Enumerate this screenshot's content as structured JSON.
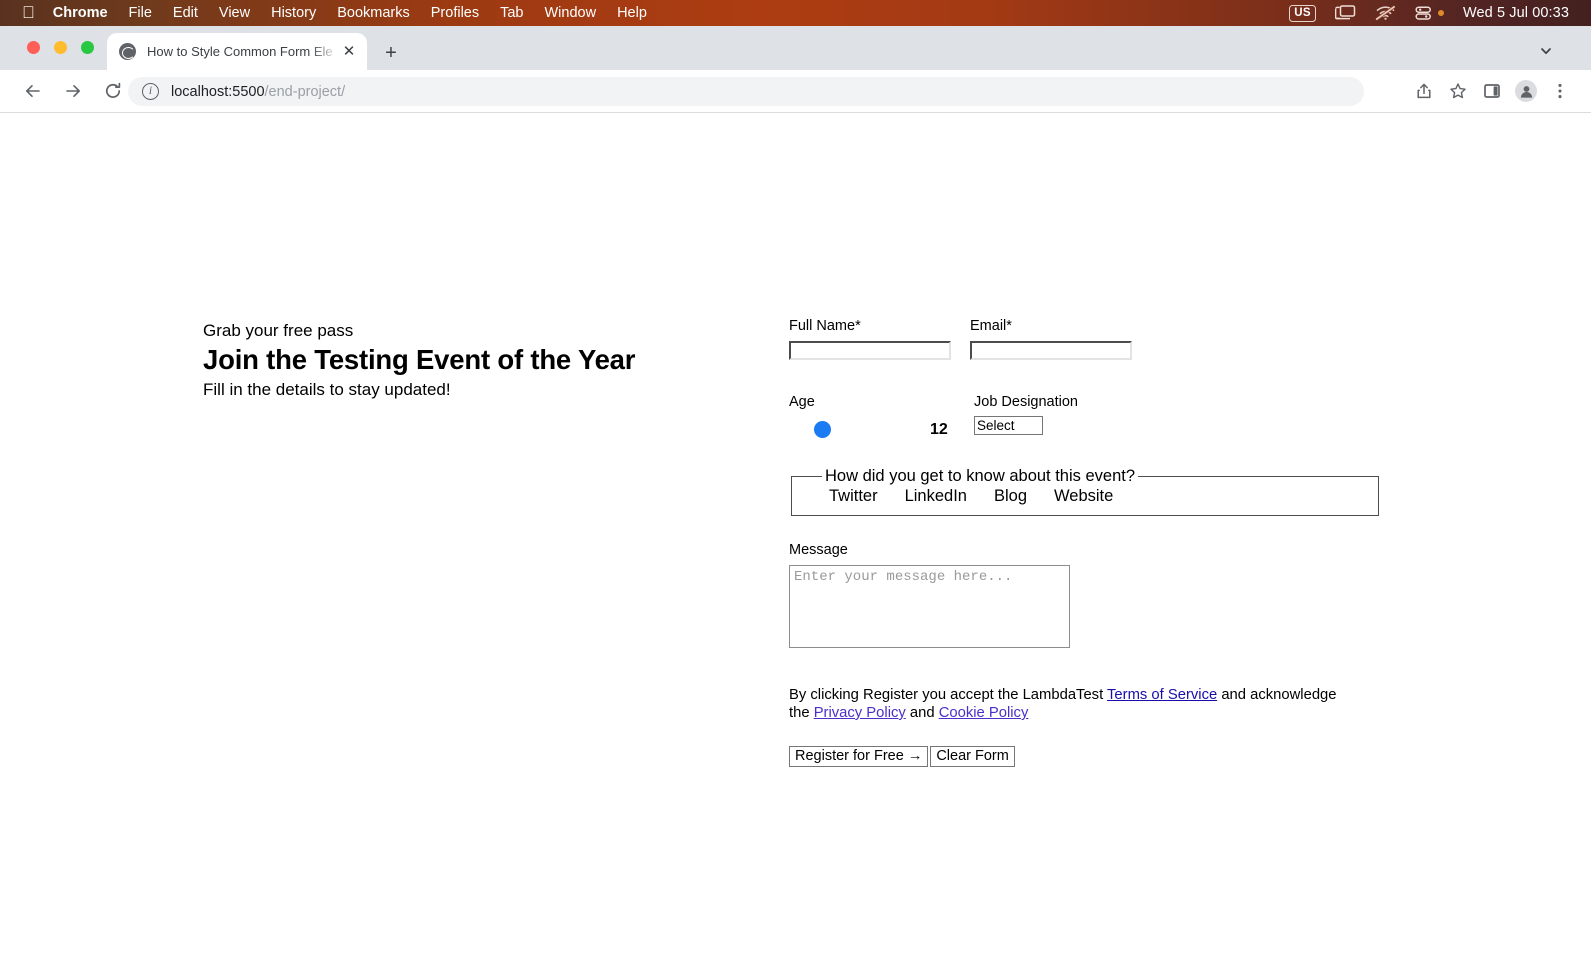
{
  "menubar": {
    "apple_icon": "apple-logo-icon",
    "items": [
      {
        "label": "Chrome",
        "bold": true
      },
      {
        "label": "File",
        "bold": false
      },
      {
        "label": "Edit",
        "bold": false
      },
      {
        "label": "View",
        "bold": false
      },
      {
        "label": "History",
        "bold": false
      },
      {
        "label": "Bookmarks",
        "bold": false
      },
      {
        "label": "Profiles",
        "bold": false
      },
      {
        "label": "Tab",
        "bold": false
      },
      {
        "label": "Window",
        "bold": false
      },
      {
        "label": "Help",
        "bold": false
      }
    ],
    "status": {
      "input_source": "US",
      "screen_mirroring_icon": "screen-mirroring-icon",
      "wifi_icon": "wifi-off-icon",
      "control_center_icon": "control-center-icon",
      "clock": "Wed 5 Jul  00:33"
    }
  },
  "browser": {
    "tab": {
      "title": "How to Style Common Form Ele",
      "favicon": "globe-icon",
      "close_label": "✕"
    },
    "new_tab_label": "+",
    "tab_list_chevron": "chevron-down-icon",
    "nav": {
      "back": "←",
      "forward": "→",
      "reload": "⟳"
    },
    "omnibox": {
      "site_info_icon": "info-circle-icon",
      "url_host": "localhost:5500",
      "url_path": "/end-project/"
    },
    "actions": {
      "share": "share-icon",
      "bookmark": "star-icon",
      "side_panel": "side-panel-icon",
      "profile": "profile-avatar-icon",
      "menu": "three-dot-menu-icon"
    }
  },
  "page": {
    "hero": {
      "eyebrow": "Grab your free pass",
      "heading": "Join the Testing Event of the Year",
      "subheading": "Fill in the details to stay updated!"
    },
    "form": {
      "full_name": {
        "label": "Full Name*",
        "value": "",
        "placeholder": ""
      },
      "email": {
        "label": "Email*",
        "value": "",
        "placeholder": ""
      },
      "age": {
        "label": "Age",
        "value": "12",
        "min": "1",
        "max": "100"
      },
      "job": {
        "label": "Job Designation",
        "selected": "Select"
      },
      "source": {
        "legend": "How did you get to know about this event?",
        "options": [
          "Twitter",
          "LinkedIn",
          "Blog",
          "Website"
        ]
      },
      "message": {
        "label": "Message",
        "value": "",
        "placeholder": "Enter your message here..."
      },
      "legal": {
        "part1": "By clicking Register you accept the LambdaTest ",
        "link_terms": "Terms of Service",
        "part2": " and acknowledge the ",
        "link_privacy": "Privacy Policy",
        "part3": " and ",
        "link_cookie": "Cookie Policy"
      },
      "buttons": {
        "submit": "Register for Free →",
        "clear": "Clear Form"
      }
    }
  },
  "colors": {
    "menubar_left": "#59321f",
    "menubar_mid": "#ad3c12",
    "menubar_right": "#43201f",
    "tabstrip": "#dee1e6",
    "omnibox": "#f1f3f4",
    "slider_thumb": "#1a7bf2",
    "link": "#1a0dab",
    "link_visited": "#4b2fc9"
  }
}
